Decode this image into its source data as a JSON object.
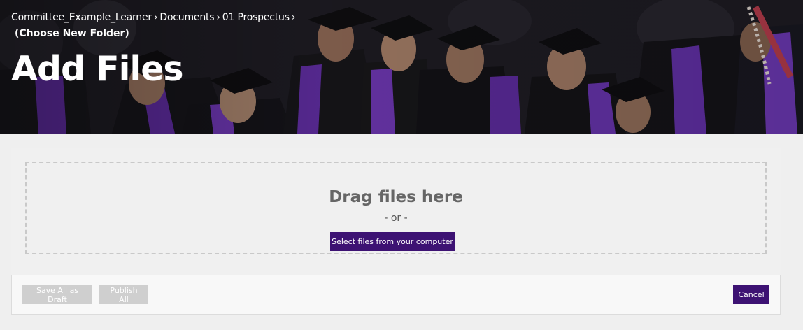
{
  "breadcrumb": {
    "items": [
      "Committee_Example_Learner",
      "Documents",
      "01 Prospectus"
    ],
    "separator": "›",
    "choose_folder": "(Choose New Folder)"
  },
  "header": {
    "title": "Add Files"
  },
  "upload": {
    "drag_text": "Drag files here",
    "or_text": "- or -",
    "select_button": "Select files from your computer"
  },
  "actions": {
    "save_draft": "Save All as Draft",
    "publish_all": "Publish All",
    "cancel": "Cancel"
  },
  "colors": {
    "accent": "#3d1273",
    "disabled": "#cfcfcf",
    "gown_purple": "#5b2a9a"
  },
  "icons": {
    "hero_image": "graduation-ceremony-photo"
  }
}
